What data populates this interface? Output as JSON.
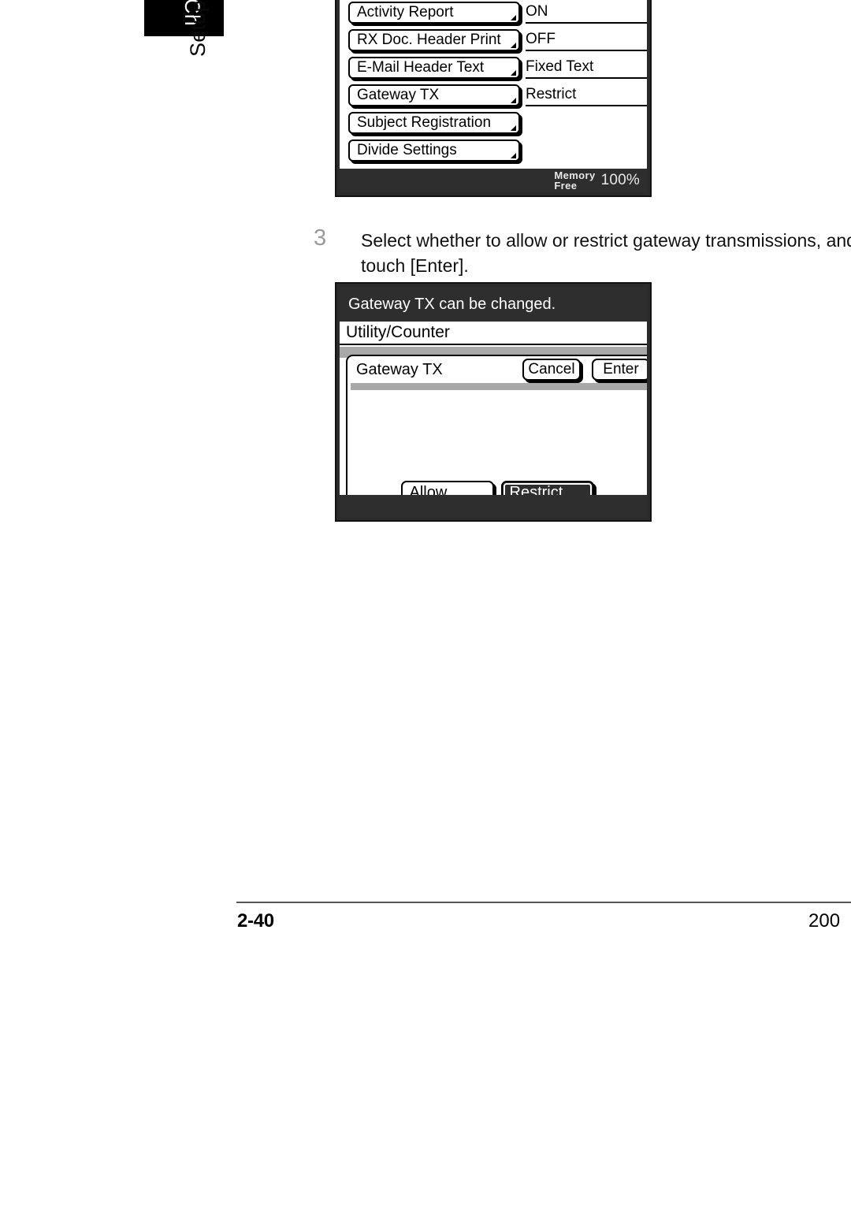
{
  "page": {
    "chapter_tab_label": "Ch",
    "side_label": "Setup",
    "footer_left": "2-40",
    "footer_right": "200"
  },
  "settings_panel": {
    "rows": [
      {
        "label": "Activity Report",
        "value": "ON"
      },
      {
        "label": "RX Doc. Header Print",
        "value": "OFF"
      },
      {
        "label": "E-Mail Header Text",
        "value": "Fixed Text"
      },
      {
        "label": "Gateway TX",
        "value": "Restrict"
      },
      {
        "label": "Subject Registration",
        "value": ""
      },
      {
        "label": "Divide Settings",
        "value": ""
      }
    ],
    "memory_label_line1": "Memory",
    "memory_label_line2": "Free",
    "memory_percent": "100%"
  },
  "step": {
    "number": "3",
    "text": "Select whether to allow or restrict gateway transmissions, and\ntouch [Enter]."
  },
  "dialog_panel": {
    "message": "Gateway TX can be changed.",
    "title": "Utility/Counter",
    "content_title": "Gateway TX",
    "cancel_label": "Cancel",
    "enter_label": "Enter",
    "choices": [
      {
        "label": "Allow",
        "selected": false
      },
      {
        "label": "Restrict",
        "selected": true
      }
    ]
  },
  "colors": {
    "lcd_dark": "#2e2e2e",
    "lcd_grey_band": "#a8a8a8",
    "step_number": "#9a9a9a"
  }
}
